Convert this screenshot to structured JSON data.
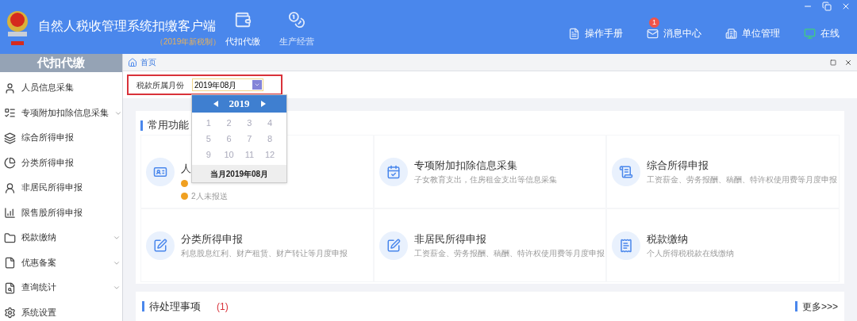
{
  "header": {
    "title": "自然人税收管理系统扣缴客户端",
    "edition": "（2019年新税制）",
    "modules": [
      {
        "label": "代扣代缴",
        "selected": true
      },
      {
        "label": "生产经营",
        "selected": false
      }
    ],
    "actions": [
      {
        "label": "操作手册"
      },
      {
        "label": "消息中心",
        "badge": "1"
      },
      {
        "label": "单位管理"
      },
      {
        "label": "在线"
      }
    ]
  },
  "sidebar": {
    "title": "代扣代缴",
    "items": [
      {
        "label": "人员信息采集",
        "has_submenu": false
      },
      {
        "label": "专项附加扣除信息采集",
        "has_submenu": true
      },
      {
        "label": "综合所得申报",
        "has_submenu": false
      },
      {
        "label": "分类所得申报",
        "has_submenu": false
      },
      {
        "label": "非居民所得申报",
        "has_submenu": false
      },
      {
        "label": "限售股所得申报",
        "has_submenu": false
      },
      {
        "label": "税款缴纳",
        "has_submenu": true
      },
      {
        "label": "优惠备案",
        "has_submenu": true
      },
      {
        "label": "查询统计",
        "has_submenu": true
      },
      {
        "label": "系统设置",
        "has_submenu": false
      }
    ]
  },
  "breadcrumb": "首页",
  "filter": {
    "label": "税款所属月份",
    "value": "2019年08月"
  },
  "month_picker": {
    "year": "2019",
    "months": [
      "1",
      "2",
      "3",
      "4",
      "5",
      "6",
      "7",
      "8",
      "9",
      "10",
      "11",
      "12"
    ],
    "current": "当月2019年08月"
  },
  "common_functions": {
    "title": "常用功能",
    "items": [
      {
        "title": "人",
        "lines": [
          {
            "kind": "status"
          },
          {
            "kind": "status",
            "text": "2人未报送"
          }
        ]
      },
      {
        "title": "专项附加扣除信息采集",
        "lines": [
          {
            "kind": "description",
            "text": "子女教育支出，住房租金支出等信息采集"
          }
        ]
      },
      {
        "title": "综合所得申报",
        "lines": [
          {
            "kind": "description",
            "text": "工资薪金、劳务报酬、稿酬、特许权使用费等月度申报"
          }
        ]
      },
      {
        "title": "分类所得申报",
        "lines": [
          {
            "kind": "description",
            "text": "利息股息红利、财产租赁、财产转让等月度申报"
          }
        ]
      },
      {
        "title": "非居民所得申报",
        "lines": [
          {
            "kind": "description",
            "text": "工资薪金、劳务报酬、稿酬、特许权使用费等月度申报"
          }
        ]
      },
      {
        "title": "税款缴纳",
        "lines": [
          {
            "kind": "description",
            "text": "个人所得税税款在线缴纳"
          }
        ]
      }
    ]
  },
  "pending": {
    "title": "待处理事项",
    "count": "(1)",
    "more": "更多>>>"
  }
}
